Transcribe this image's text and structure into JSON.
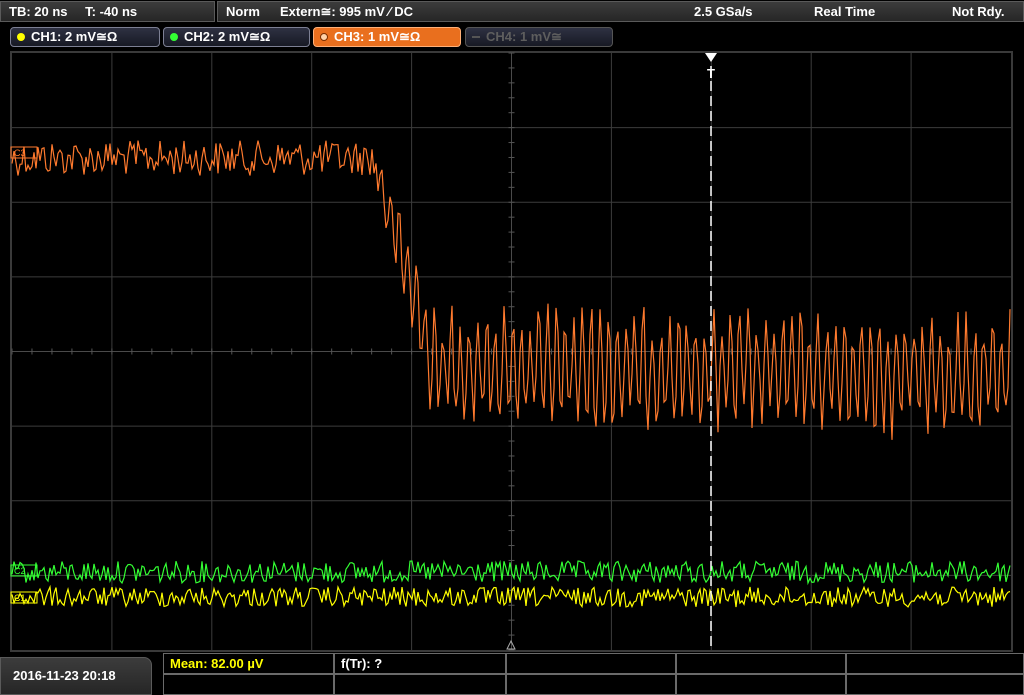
{
  "top_bar": {
    "timebase": "TB: 20 ns",
    "trigger_time": "T: -40 ns",
    "trigger_mode": "Norm",
    "trigger_source": "Extern≅: 995 mV ⁄ DC",
    "sample_rate": "2.5 GSa/s",
    "acquisition": "Real Time",
    "status": "Not Rdy."
  },
  "channels": [
    {
      "label": "CH1: 2 mV≅Ω",
      "color": "#ffff00",
      "active": true
    },
    {
      "label": "CH2: 2 mV≅Ω",
      "color": "#33ff33",
      "active": true
    },
    {
      "label": "CH3: 1 mV≅Ω",
      "color": "#ff7a2e",
      "active": true,
      "selected": true
    },
    {
      "label": "CH4: 1 mV≅",
      "color": "#555555",
      "active": false
    }
  ],
  "trigger_marker": "T",
  "waveform_markers": {
    "ch3": "C3",
    "ch2": "C2",
    "ch1": "C1"
  },
  "colors": {
    "grid": "#3c3c3c",
    "trigger_line": "#ffffff",
    "ch1": "#ffff00",
    "ch2": "#33ff33",
    "ch3": "#ff7a2e"
  },
  "bottom_bar": {
    "datetime": "2016-11-23 20:18",
    "measurements": [
      {
        "label": "Mean: 82.00 µV"
      },
      {
        "label": "f(Tr): ?"
      }
    ]
  }
}
